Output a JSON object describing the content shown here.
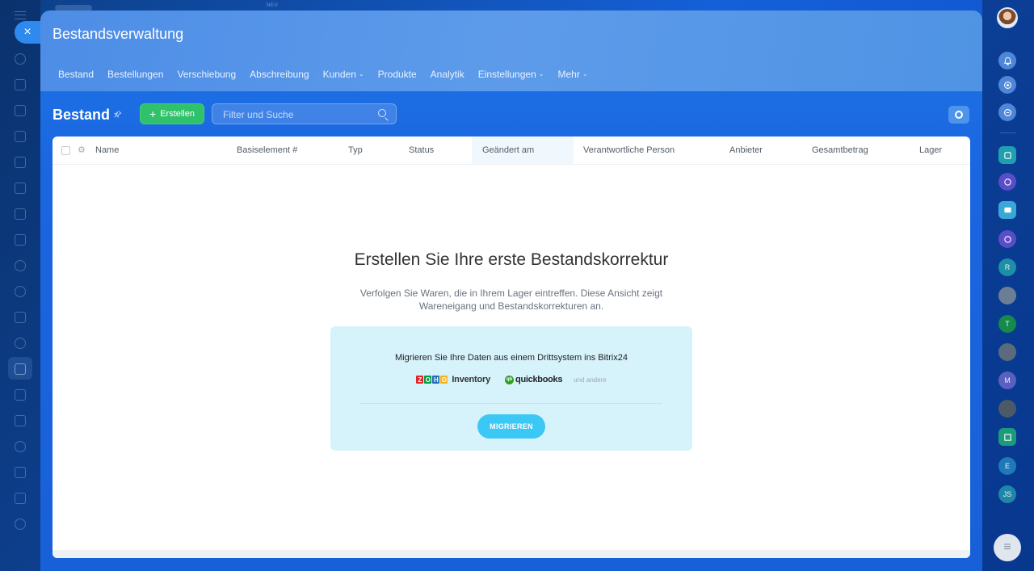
{
  "topbar": {
    "badge": "NEU"
  },
  "close": {
    "icon": "close-icon",
    "label": "×"
  },
  "panel": {
    "title": "Bestandsverwaltung",
    "nav": [
      {
        "label": "Bestand",
        "dropdown": false
      },
      {
        "label": "Bestellungen",
        "dropdown": false
      },
      {
        "label": "Verschiebung",
        "dropdown": false
      },
      {
        "label": "Abschreibung",
        "dropdown": false
      },
      {
        "label": "Kunden",
        "dropdown": true
      },
      {
        "label": "Produkte",
        "dropdown": false
      },
      {
        "label": "Analytik",
        "dropdown": false
      },
      {
        "label": "Einstellungen",
        "dropdown": true
      },
      {
        "label": "Mehr",
        "dropdown": true
      }
    ]
  },
  "toolbar": {
    "page_title": "Bestand",
    "create_label": "Erstellen",
    "search_placeholder": "Filter und Suche"
  },
  "grid": {
    "columns": [
      "Name",
      "Basiselement #",
      "Typ",
      "Status",
      "Geändert am",
      "Verantwortliche Person",
      "Anbieter",
      "Gesamtbetrag",
      "Lager"
    ],
    "sorted_column": "Geändert am"
  },
  "empty_state": {
    "title": "Erstellen Sie Ihre erste Bestandskorrektur",
    "description": "Verfolgen Sie Waren, die in Ihrem Lager eintreffen. Diese Ansicht zeigt Wareneigang und Bestandskorrekturen an.",
    "migrate": {
      "title": "Migrieren Sie Ihre Daten aus einem Drittsystem ins Bitrix24",
      "logo_zoho_letters": [
        "Z",
        "O",
        "H",
        "O"
      ],
      "logo_zoho_product": "Inventory",
      "logo_qb_badge": "qb",
      "logo_qb_name": "quickbooks",
      "others": "und andere",
      "button": "MIGRIEREN"
    }
  },
  "right_rail": {
    "letters": [
      "R",
      "T",
      "M",
      "E",
      "JS"
    ]
  },
  "colors": {
    "accent": "#2fc26b",
    "migrate_button": "#3bc8f5",
    "zoho": [
      "#e42527",
      "#089949",
      "#226db4",
      "#f9b21d"
    ]
  }
}
